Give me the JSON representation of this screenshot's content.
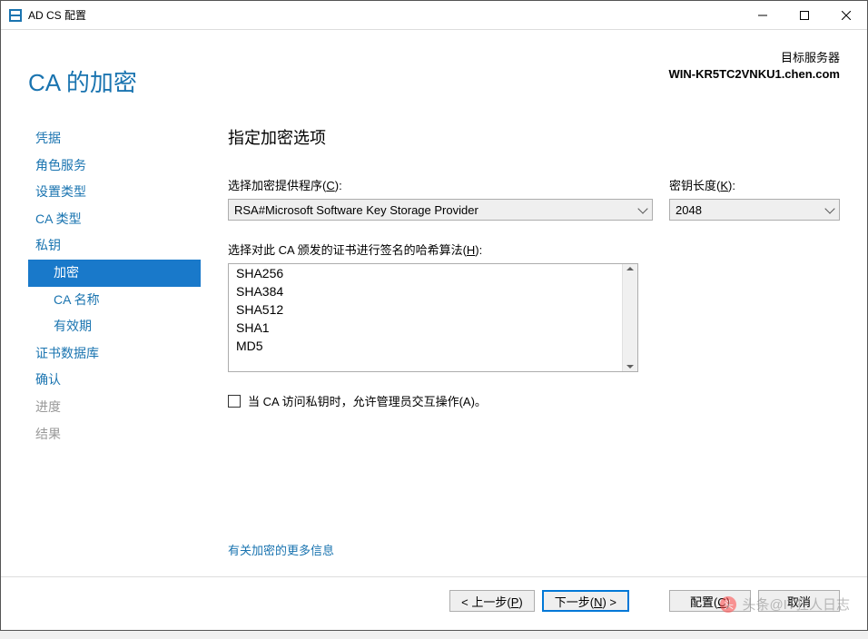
{
  "titlebar": {
    "title": "AD CS 配置"
  },
  "header": {
    "page_heading": "CA 的加密",
    "server_label": "目标服务器",
    "server_name": "WIN-KR5TC2VNKU1.chen.com"
  },
  "sidebar": {
    "items": [
      {
        "label": "凭据",
        "state": "normal"
      },
      {
        "label": "角色服务",
        "state": "normal"
      },
      {
        "label": "设置类型",
        "state": "normal"
      },
      {
        "label": "CA 类型",
        "state": "normal"
      },
      {
        "label": "私钥",
        "state": "normal"
      },
      {
        "label": "加密",
        "state": "selected",
        "sub": true
      },
      {
        "label": "CA 名称",
        "state": "normal",
        "sub": true
      },
      {
        "label": "有效期",
        "state": "normal",
        "sub": true
      },
      {
        "label": "证书数据库",
        "state": "normal"
      },
      {
        "label": "确认",
        "state": "normal"
      },
      {
        "label": "进度",
        "state": "disabled"
      },
      {
        "label": "结果",
        "state": "disabled"
      }
    ]
  },
  "main": {
    "title": "指定加密选项",
    "provider_label_pre": "选择加密提供程序(",
    "provider_label_ul": "C",
    "provider_label_post": "):",
    "provider_value": "RSA#Microsoft Software Key Storage Provider",
    "keylen_label_pre": "密钥长度(",
    "keylen_label_ul": "K",
    "keylen_label_post": "):",
    "keylen_value": "2048",
    "hash_label_pre": "选择对此 CA 颁发的证书进行签名的哈希算法(",
    "hash_label_ul": "H",
    "hash_label_post": "):",
    "hash_options": [
      "SHA256",
      "SHA384",
      "SHA512",
      "SHA1",
      "MD5"
    ],
    "checkbox_label_pre": "当 CA 访问私钥时，允许管理员交互操作(",
    "checkbox_label_ul": "A",
    "checkbox_label_post": ")。",
    "more_info": "有关加密的更多信息"
  },
  "footer": {
    "prev_pre": "< 上一步(",
    "prev_ul": "P",
    "prev_post": ")",
    "next_pre": "下一步(",
    "next_ul": "N",
    "next_post": ") >",
    "configure_pre": "配置(",
    "configure_ul": "C",
    "configure_post": ")",
    "cancel": "取消"
  },
  "watermark": "头条@IT狂人日志"
}
